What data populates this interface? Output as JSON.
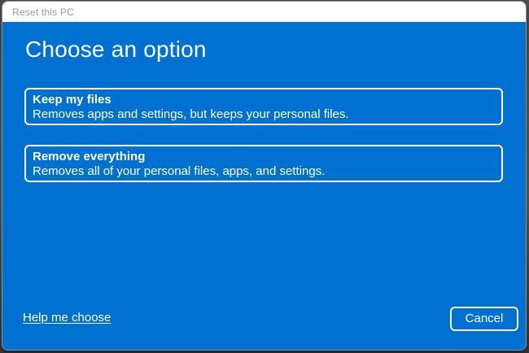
{
  "colors": {
    "body-blue": "#0070D1",
    "titlebar-bg": "#ffffff",
    "titlebar-text": "#9a9a9a",
    "window-border": "#949494"
  },
  "window": {
    "title": "Reset this PC"
  },
  "main": {
    "heading": "Choose an option",
    "options": [
      {
        "title": "Keep my files",
        "description": "Removes apps and settings, but keeps your personal files."
      },
      {
        "title": "Remove everything",
        "description": "Removes all of your personal files, apps, and settings."
      }
    ]
  },
  "footer": {
    "help_link": "Help me choose",
    "cancel_label": "Cancel"
  }
}
